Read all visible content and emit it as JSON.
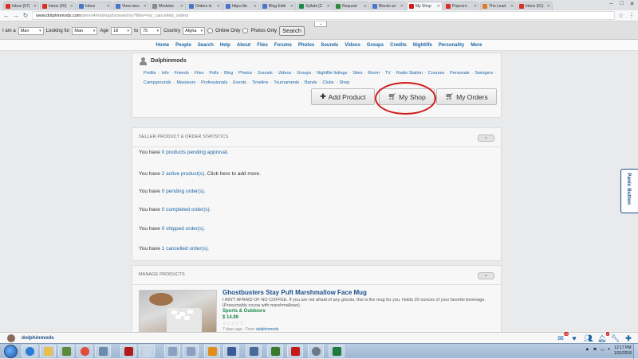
{
  "browser": {
    "tabs": [
      {
        "label": "Inbox (57)",
        "color": "#d93025",
        "active": false
      },
      {
        "label": "Inbox (26)",
        "color": "#d93025",
        "active": false
      },
      {
        "label": "Inbox",
        "color": "#4a76c9",
        "active": false
      },
      {
        "label": "View mes",
        "color": "#4a76c9",
        "active": false
      },
      {
        "label": "Modules",
        "color": "#888888",
        "active": false
      },
      {
        "label": "Orders in",
        "color": "#4a76c9",
        "active": false
      },
      {
        "label": "https://to",
        "color": "#4a76c9",
        "active": false
      },
      {
        "label": "Blog Editi",
        "color": "#4a76c9",
        "active": false
      },
      {
        "label": "Syllabi (C",
        "color": "#1a8a4a",
        "active": false
      },
      {
        "label": "Request",
        "color": "#2b8a3e",
        "active": false
      },
      {
        "label": "Blocks wi",
        "color": "#4a76c9",
        "active": false
      },
      {
        "label": "My Shop",
        "color": "#d11a1a",
        "active": true
      },
      {
        "label": "Popcorn",
        "color": "#d93025",
        "active": false
      },
      {
        "label": "The Lead",
        "color": "#e07b2a",
        "active": false
      },
      {
        "label": "Inbox (51)",
        "color": "#d93025",
        "active": false
      }
    ],
    "url_host": "www.dolphinmods.com",
    "url_path": "/demo4/m/shop/browse/my?filter=my_cancelled_orders"
  },
  "search_bar": {
    "i_am_label": "I am a",
    "i_am_value": "Man",
    "looking_for_label": "Looking for",
    "looking_for_value": "Man",
    "age_label": "Age",
    "age_from": "18",
    "age_to_label": "to",
    "age_to": "75",
    "country_label": "Country",
    "country_value": "Afgha",
    "online_only": "Online Only",
    "photos_only": "Photos Only",
    "search_button": "Search"
  },
  "site_nav": [
    "Home",
    "People",
    "Search",
    "Help",
    "About",
    "Files",
    "Forums",
    "Photos",
    "Sounds",
    "Videos",
    "Groups",
    "Credits",
    "Nightlife",
    "Personality",
    "More"
  ],
  "profile": {
    "username": "Dolphinmods",
    "links": [
      "Profile",
      "Info",
      "Friends",
      "Files",
      "Polls",
      "Blog",
      "Photos",
      "Sounds",
      "Videos",
      "Groups",
      "Nightlife listings",
      "Sites",
      "Room",
      "TV",
      "Radio Station",
      "Courses",
      "Personals",
      "Swingers",
      "Campgrounds",
      "Masseurs",
      "Professionals",
      "Events",
      "Timeline",
      "Tournaments",
      "Bands",
      "Clubs",
      "Shop"
    ],
    "add_product": "Add Product",
    "my_shop": "My Shop",
    "my_orders": "My Orders"
  },
  "stats": {
    "heading": "SELLER PRODUCT & ORDER STATISTICS",
    "rows": [
      {
        "pre": "You have ",
        "link": "0 products pending approval",
        "post": "."
      },
      {
        "pre": "You have ",
        "link": "2 active product(s)",
        "post": ". Click here to add more."
      },
      {
        "pre": "You have ",
        "link": "0 pending order(s)",
        "post": "."
      },
      {
        "pre": "You have ",
        "link": "0 completed order(s)",
        "post": "."
      },
      {
        "pre": "You have ",
        "link": "0 shipped order(s)",
        "post": "."
      },
      {
        "pre": "You have ",
        "link": "1 cancelled order(s)",
        "post": "."
      }
    ]
  },
  "manage": {
    "heading": "MANAGE PRODUCTS",
    "product": {
      "title": "Ghostbusters Stay Puft Marshmallow Face Mug",
      "description": "I AIN'T AFRAID OF NO COFFEE. If you are not afraid of any ghosts, this is the mug for you. Holds 20 ounces of your favorite beverage. (Presumably cocoa with marshmallows)",
      "category": "Sports & Outdoors",
      "price": "$ 14.99",
      "stars": "☆☆☆☆☆",
      "meta_pre": "7 days ago · From ",
      "meta_author": "dolphinmods"
    }
  },
  "panic_button": "Panic Button",
  "footer": {
    "username": "dolphinmods",
    "mail_badge": "55",
    "bell_badge": "2"
  },
  "taskbar": {
    "time": "12:17 PM",
    "date": "1/31/2018"
  }
}
